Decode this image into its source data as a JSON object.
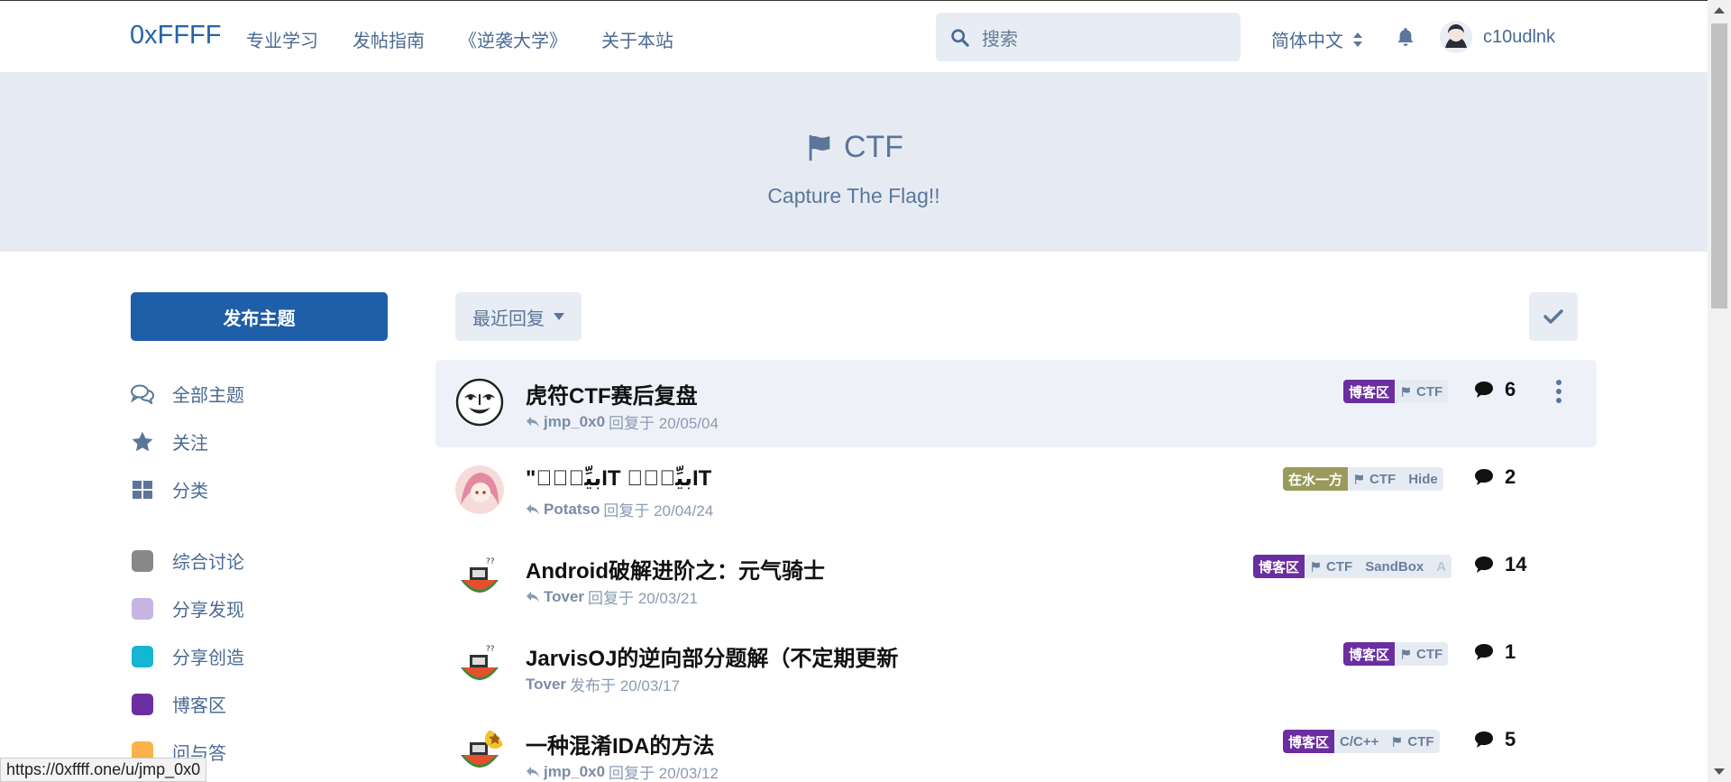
{
  "header": {
    "logo": "0xFFFF",
    "nav": [
      "专业学习",
      "发帖指南",
      "《逆袭大学》",
      "关于本站"
    ],
    "search_placeholder": "搜索",
    "language": "简体中文",
    "username": "c10udlnk"
  },
  "hero": {
    "title": "CTF",
    "subtitle": "Capture The Flag!!"
  },
  "sidebar": {
    "new_discussion": "发布主题",
    "nav": [
      {
        "label": "全部主题",
        "icon": "comments-icon"
      },
      {
        "label": "关注",
        "icon": "star-icon"
      },
      {
        "label": "分类",
        "icon": "grid-icon"
      }
    ],
    "tags": [
      {
        "label": "综合讨论",
        "color": "#888888"
      },
      {
        "label": "分享发现",
        "color": "#c6b5e3"
      },
      {
        "label": "分享创造",
        "color": "#14b6d1"
      },
      {
        "label": "博客区",
        "color": "#6a2ea0"
      },
      {
        "label": "问与答",
        "color": "#fbb24a"
      }
    ]
  },
  "toolbar": {
    "sort_label": "最近回复"
  },
  "discussions": [
    {
      "title": "虎符CTF赛后复盘",
      "author": "jmp_0x0",
      "action": "回复于 20/05/04",
      "reply_icon": true,
      "tags": {
        "primary": "博客区",
        "primary_color": "#6a2ea0",
        "rest": [
          "CTF"
        ]
      },
      "replies": "6"
    },
    {
      "title": "\"ﺑﻴِّﺮُؚIT ﺑﻴِّﺮُؚIT",
      "author": "Potatso",
      "action": "回复于 20/04/24",
      "reply_icon": true,
      "tags": {
        "primary": "在水一方",
        "primary_color": "#9a9a5c",
        "rest": [
          "CTF",
          "Hide"
        ]
      },
      "replies": "2"
    },
    {
      "title": "Android破解进阶之：元气骑士",
      "author": "Tover",
      "action": "回复于 20/03/21",
      "reply_icon": true,
      "tags": {
        "primary": "博客区",
        "primary_color": "#6a2ea0",
        "rest": [
          "CTF",
          "SandBox",
          "A"
        ]
      },
      "replies": "14"
    },
    {
      "title": "JarvisOJ的逆向部分题解（不定期更新",
      "author": "Tover",
      "action": "发布于 20/03/17",
      "reply_icon": false,
      "tags": {
        "primary": "博客区",
        "primary_color": "#6a2ea0",
        "rest": [
          "CTF"
        ]
      },
      "replies": "1"
    },
    {
      "title": "一种混淆IDA的方法",
      "author": "jmp_0x0",
      "action": "回复于 20/03/12",
      "reply_icon": true,
      "tags": {
        "primary": "博客区",
        "primary_color": "#6a2ea0",
        "rest": [
          "C/C++",
          "CTF"
        ]
      },
      "replies": "5"
    }
  ],
  "status_url": "https://0xffff.one/u/jmp_0x0"
}
